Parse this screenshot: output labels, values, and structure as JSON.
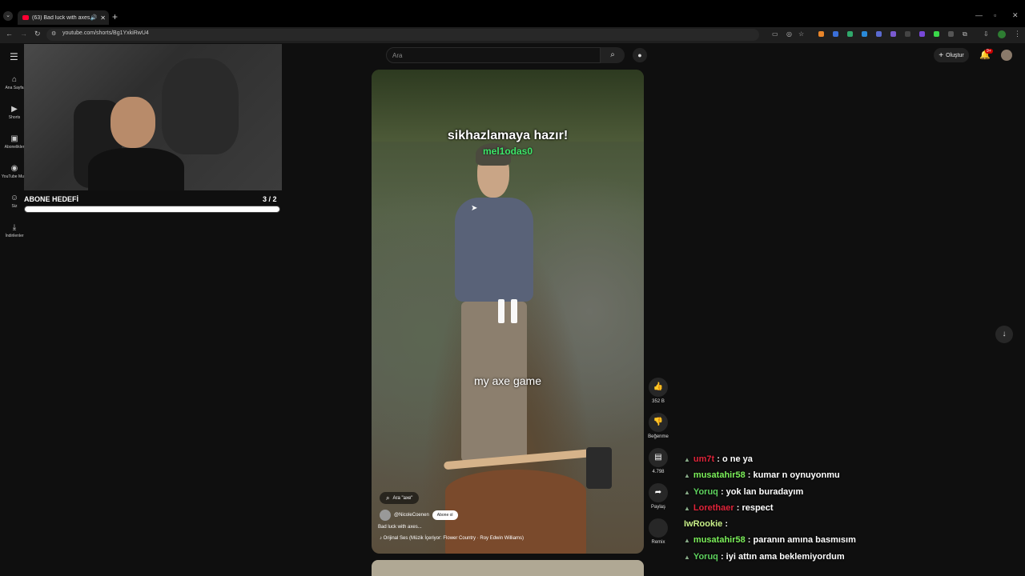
{
  "browser": {
    "tab_title": "(63) Bad luck with axes... -",
    "url": "youtube.com/shorts/Bg1YxkiRwU4"
  },
  "sidebar": {
    "items": [
      {
        "label": "Ana Sayfa",
        "icon": "home-icon"
      },
      {
        "label": "Shorts",
        "icon": "shorts-icon"
      },
      {
        "label": "Abonelikler",
        "icon": "subscriptions-icon"
      },
      {
        "label": "YouTube Mu...",
        "icon": "music-icon"
      },
      {
        "label": "Siz",
        "icon": "user-icon"
      },
      {
        "label": "İndirilenler",
        "icon": "download-icon"
      }
    ]
  },
  "header": {
    "search_placeholder": "Ara",
    "create_label": "Oluştur",
    "notifications_badge": "9+"
  },
  "stream": {
    "goal_label": "ABONE HEDEFİ",
    "goal_count": "3 / 2",
    "goal_progress": 1.0
  },
  "video": {
    "overlay_title": "sikhazlamaya hazır!",
    "overlay_name": "mel1odas0",
    "caption": "my axe game",
    "search_pill": "Ara \"axe\"",
    "channel": "@NicoleCoenen",
    "subscribe_label": "Abone ol",
    "title": "Bad luck with axes...",
    "music": "Orijinal Ses (Müzik İçeriyor: Flower Country · Roy Edwin Williams)"
  },
  "actions": {
    "like_count": "352 B",
    "dislike_label": "Beğenme",
    "comment_count": "4.798",
    "share_label": "Paylaş",
    "remix_label": "Remix"
  },
  "chat": [
    {
      "user": "um7t",
      "text": " : o ne ya",
      "color": "#e0243a"
    },
    {
      "user": "musatahir58",
      "text": " : kumar n oynuyonmu",
      "color": "#7cf05a"
    },
    {
      "user": "Yoruq",
      "text": " : yok lan buradayım",
      "color": "#5fd35f"
    },
    {
      "user": "Lorethaer",
      "text": " : respect",
      "color": "#e0243a"
    },
    {
      "user": "IwRookie",
      "text": " : ",
      "color": "#c9f08a"
    },
    {
      "user": "musatahir58",
      "text": " : paranın amına basmısım",
      "color": "#7cf05a"
    },
    {
      "user": "Yoruq",
      "text": " : iyi attın ama beklemiyordum",
      "color": "#5fd35f"
    }
  ]
}
